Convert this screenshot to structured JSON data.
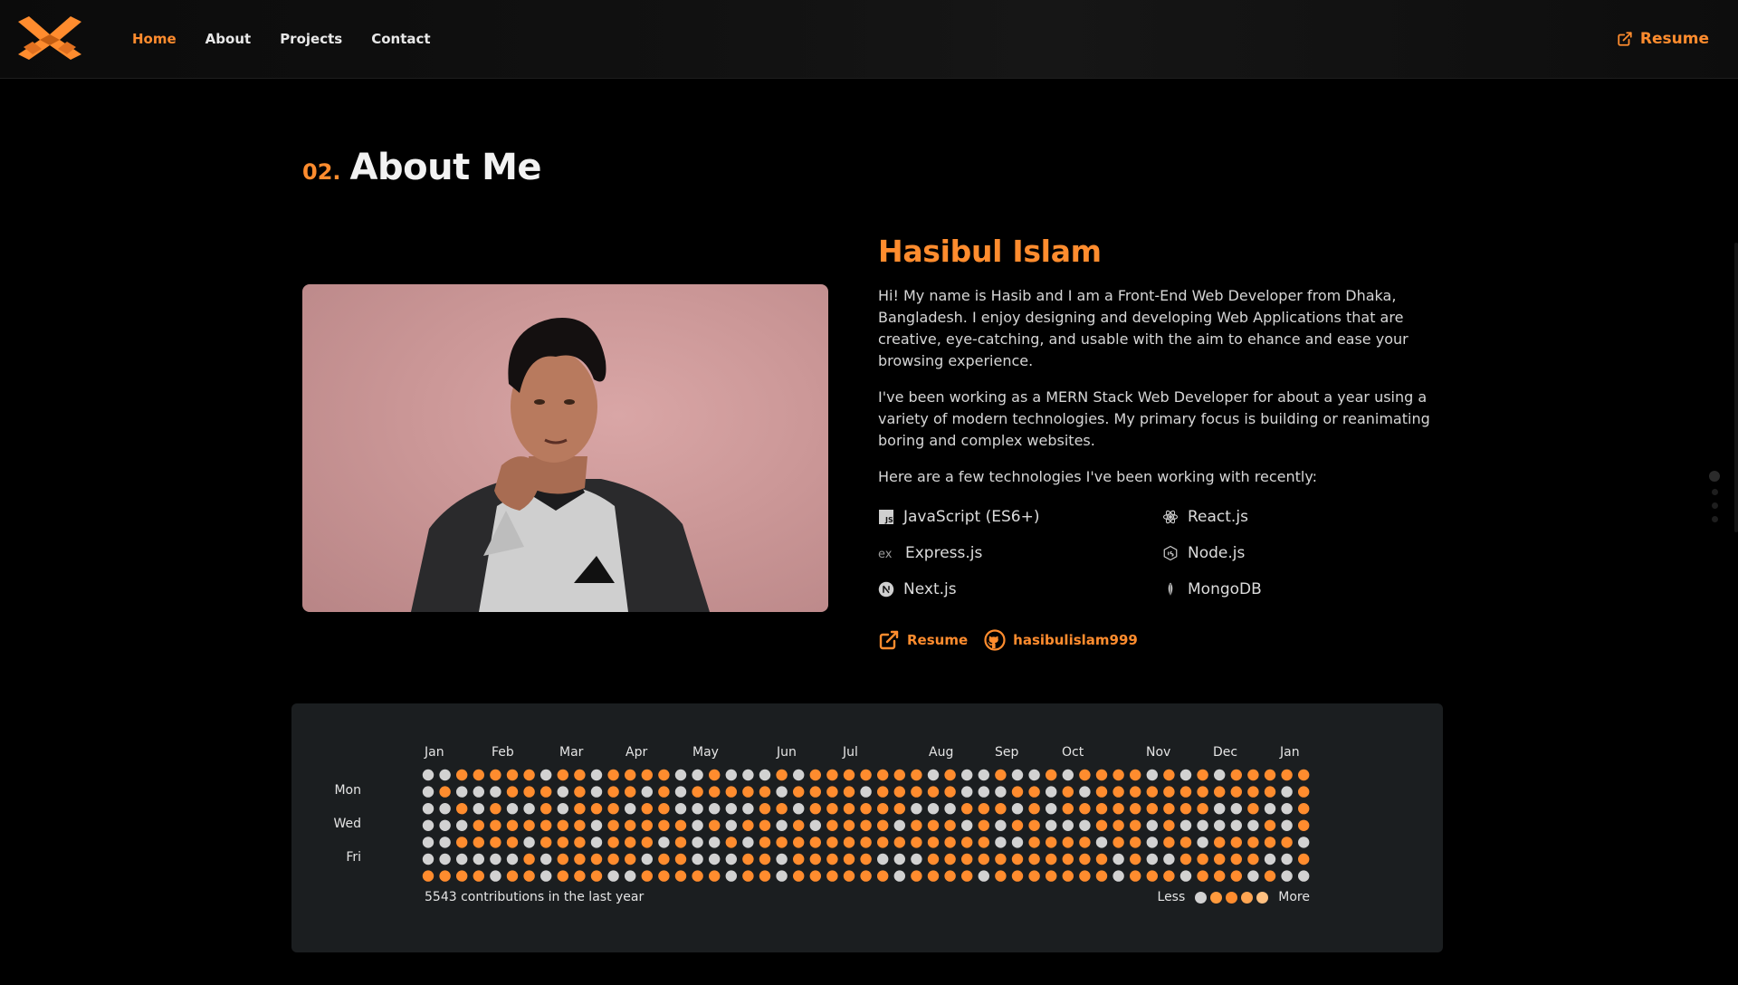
{
  "nav": {
    "links": [
      {
        "label": "Home",
        "active": true
      },
      {
        "label": "About",
        "active": false
      },
      {
        "label": "Projects",
        "active": false
      },
      {
        "label": "Contact",
        "active": false
      }
    ],
    "resume_label": "Resume"
  },
  "section": {
    "number": "02.",
    "title": "About Me"
  },
  "bio": {
    "name": "Hasibul Islam",
    "paragraphs": [
      "Hi! My name is Hasib and I am a Front-End Web Developer from Dhaka, Bangladesh. I enjoy designing and developing Web Applications that are creative, eye-catching, and usable with the aim to ehance and ease your browsing experience.",
      "I've been working as a MERN Stack Web Developer for about a year using a variety of modern technologies. My primary focus is building or reanimating boring and complex websites.",
      "Here are a few technologies I've been working with recently:"
    ],
    "technologies": [
      {
        "label": "JavaScript (ES6+)",
        "icon": "javascript-icon"
      },
      {
        "label": "React.js",
        "icon": "react-icon"
      },
      {
        "label": "Express.js",
        "icon": "express-icon"
      },
      {
        "label": "Node.js",
        "icon": "nodejs-icon"
      },
      {
        "label": "Next.js",
        "icon": "nextjs-icon"
      },
      {
        "label": "MongoDB",
        "icon": "mongodb-icon"
      }
    ],
    "links": {
      "resume": "Resume",
      "github": "hasibulislam999"
    }
  },
  "contributions": {
    "months": [
      "Jan",
      "Feb",
      "Mar",
      "Apr",
      "May",
      "Jun",
      "Jul",
      "Aug",
      "Sep",
      "Oct",
      "Nov",
      "Dec",
      "Jan"
    ],
    "day_labels": [
      "Mon",
      "Wed",
      "Fri"
    ],
    "summary": "5543 contributions in the last year",
    "legend_less": "Less",
    "legend_more": "More",
    "colors": {
      "empty": "#d2d2d2",
      "active": "#ff8c2e",
      "levels": [
        "#d2d2d2",
        "#ff9a3d",
        "#ff8c2e",
        "#ffa552",
        "#ffc081"
      ]
    }
  },
  "colors": {
    "accent": "#ff8c2e",
    "background": "#000000",
    "card": "#1b1e20"
  }
}
